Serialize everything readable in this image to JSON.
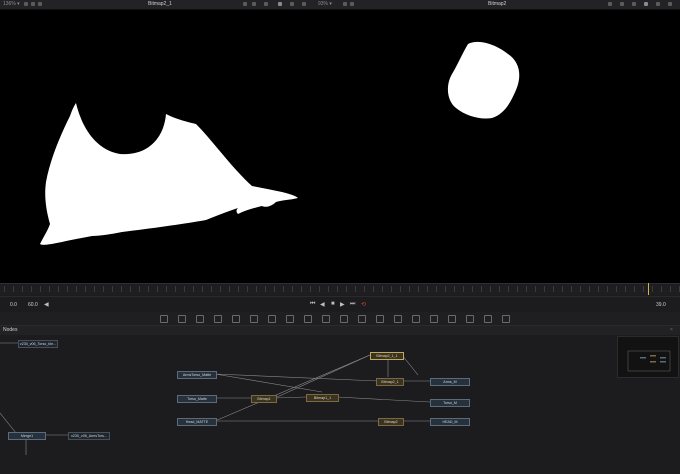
{
  "viewer_left": {
    "zoom": "136% ▾",
    "title": "Bitmap2_1"
  },
  "viewer_center": {
    "zoom": "93% ▾"
  },
  "viewer_right": {
    "title": "Bitmap2"
  },
  "transport": {
    "start": "0.0",
    "end": "60.0",
    "current": "39.0"
  },
  "nodes_panel": {
    "title": "Nodes"
  },
  "nodes": {
    "clip": "v230_v06_Torso_ble...",
    "arms_torso_matte": "ArmsTorso_Matte",
    "torso_matte": "Torso_Matte",
    "head_matte": "Head_MATTE",
    "bitmap1": "Bitmap1",
    "bitmap1_1": "Bitmap1_1",
    "bitmap2_1_1": "Bitmap2_1_1",
    "bitmap2_1": "Bitmap2_1",
    "bitmap2": "Bitmap2",
    "arms_m": "Arms_M",
    "torso_m": "Torso_M",
    "head_m": "HEAD_M",
    "merge1": "Merge1",
    "arms_out": "v230_v06_ArmsTors..."
  },
  "colors": {
    "accent_playhead": "#c9b94b",
    "record_button": "#d0412f",
    "bitmap_node": "#3a3322",
    "matte_node": "#27313b"
  }
}
